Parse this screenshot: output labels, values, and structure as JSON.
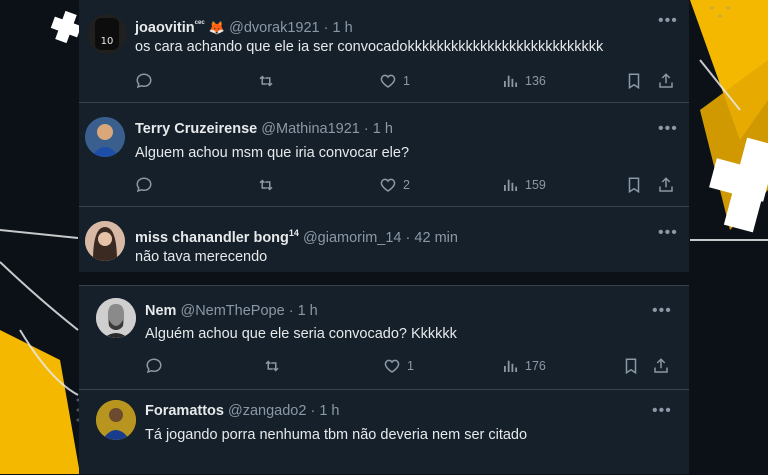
{
  "tweets": [
    {
      "name": "joaovitin",
      "name_sup": "ᶜᵉᶜ",
      "name_emoji": "🦊",
      "handle": "@dvorak1921",
      "dot": "·",
      "time": "1 h",
      "text": "os cara achando que ele ia ser convocadokkkkkkkkkkkkkkkkkkkkkkkkkkk",
      "likes": "1",
      "views": "136",
      "avatar_jersey": "10"
    },
    {
      "name": "Terry Cruzeirense",
      "handle": "@Mathina1921",
      "dot": "·",
      "time": "1 h",
      "text": "Alguem achou msm que iria convocar ele?",
      "likes": "2",
      "views": "159"
    },
    {
      "name": "miss chanandler bong",
      "name_sup": "14",
      "handle": "@giamorim_14",
      "dot": "·",
      "time": "42 min",
      "text": "não tava merecendo"
    },
    {
      "name": "Nem",
      "handle": "@NemThePope",
      "dot": "·",
      "time": "1 h",
      "text": "Alguém achou que ele seria convocado? Kkkkkk",
      "likes": "1",
      "views": "176"
    },
    {
      "name": "Foramattos",
      "handle": "@zangado2",
      "dot": "·",
      "time": "1 h",
      "text": "Tá jogando porra nenhuma tbm não deveria nem ser citado"
    }
  ],
  "colors": {
    "card_bg": "#15202b",
    "muted": "#8b98a5",
    "text": "#e7e9ea",
    "accent_yellow": "#f5b800"
  }
}
